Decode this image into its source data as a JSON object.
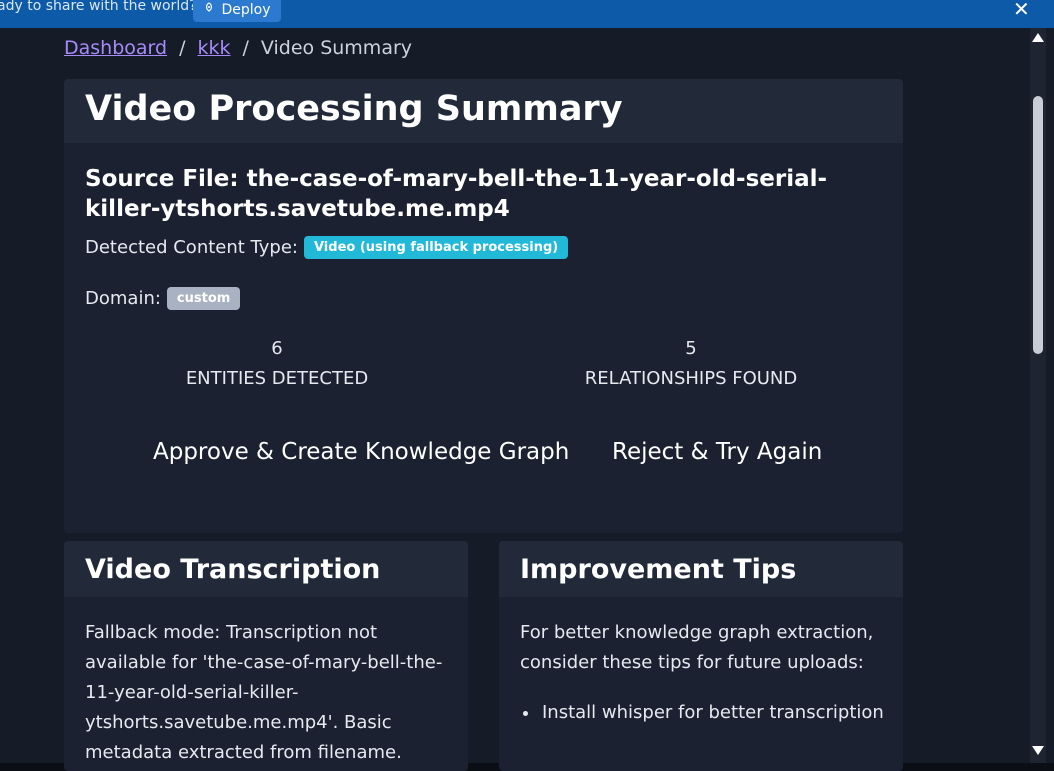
{
  "topbar": {
    "message": "ady to share with the world?",
    "deploy_label": "Deploy"
  },
  "breadcrumb": {
    "items": [
      "Dashboard",
      "kkk"
    ],
    "current": "Video Summary"
  },
  "summary": {
    "title": "Video Processing Summary",
    "source_file": "Source File: the-case-of-mary-bell-the-11-year-old-serial-killer-ytshorts.savetube.me.mp4",
    "content_type_label": "Detected Content Type:",
    "content_type_badge": "Video (using fallback processing)",
    "domain_label": "Domain:",
    "domain_badge": "custom",
    "stats": [
      {
        "value": "6",
        "label": "ENTITIES DETECTED"
      },
      {
        "value": "5",
        "label": "RELATIONSHIPS FOUND"
      }
    ],
    "approve_label": "Approve & Create Knowledge Graph",
    "reject_label": "Reject & Try Again"
  },
  "transcription": {
    "title": "Video Transcription",
    "text": "Fallback mode: Transcription not available for 'the-case-of-mary-bell-the-11-year-old-serial-killer-ytshorts.savetube.me.mp4'. Basic metadata extracted from filename."
  },
  "tips": {
    "title": "Improvement Tips",
    "intro": "For better knowledge graph extraction, consider these tips for future uploads:",
    "items": [
      "Install whisper for better transcription"
    ]
  },
  "colors": {
    "background": "#151b27",
    "card": "#1b2130",
    "topbar": "#0d5aa9",
    "info_badge": "#22b8d8",
    "link": "#a78bfa"
  }
}
